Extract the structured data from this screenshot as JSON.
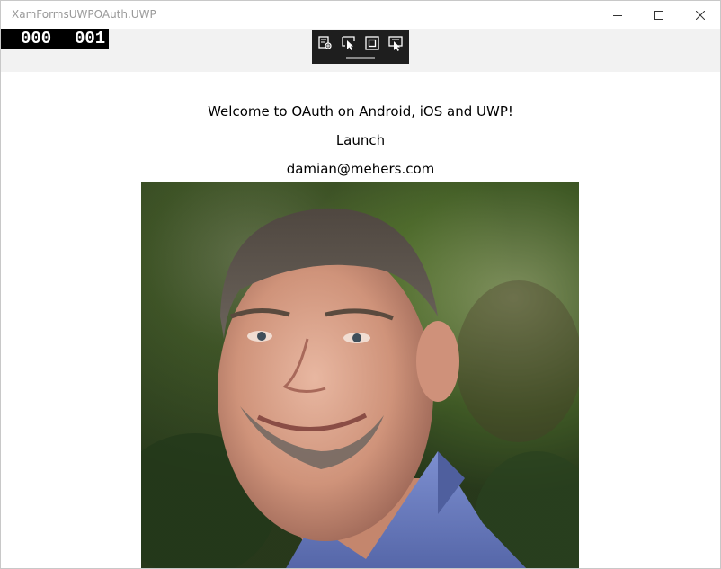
{
  "window": {
    "title": "XamFormsUWPOAuth.UWP"
  },
  "frame_counter": {
    "left": "000",
    "right": "001"
  },
  "debug_toolbar": {
    "buttons": [
      "live-visual-tree-icon",
      "select-element-icon",
      "display-layout-adorners-icon",
      "track-focus-icon"
    ]
  },
  "content": {
    "welcome": "Welcome to OAuth on Android, iOS and UWP!",
    "launch": "Launch",
    "email": "damian@mehers.com"
  },
  "colors": {
    "title_text": "#999999",
    "strip": "#f2f2f2",
    "toolbar": "#1e1e1e",
    "counter_bg": "#000000",
    "shirt": "#6f7fc0"
  }
}
